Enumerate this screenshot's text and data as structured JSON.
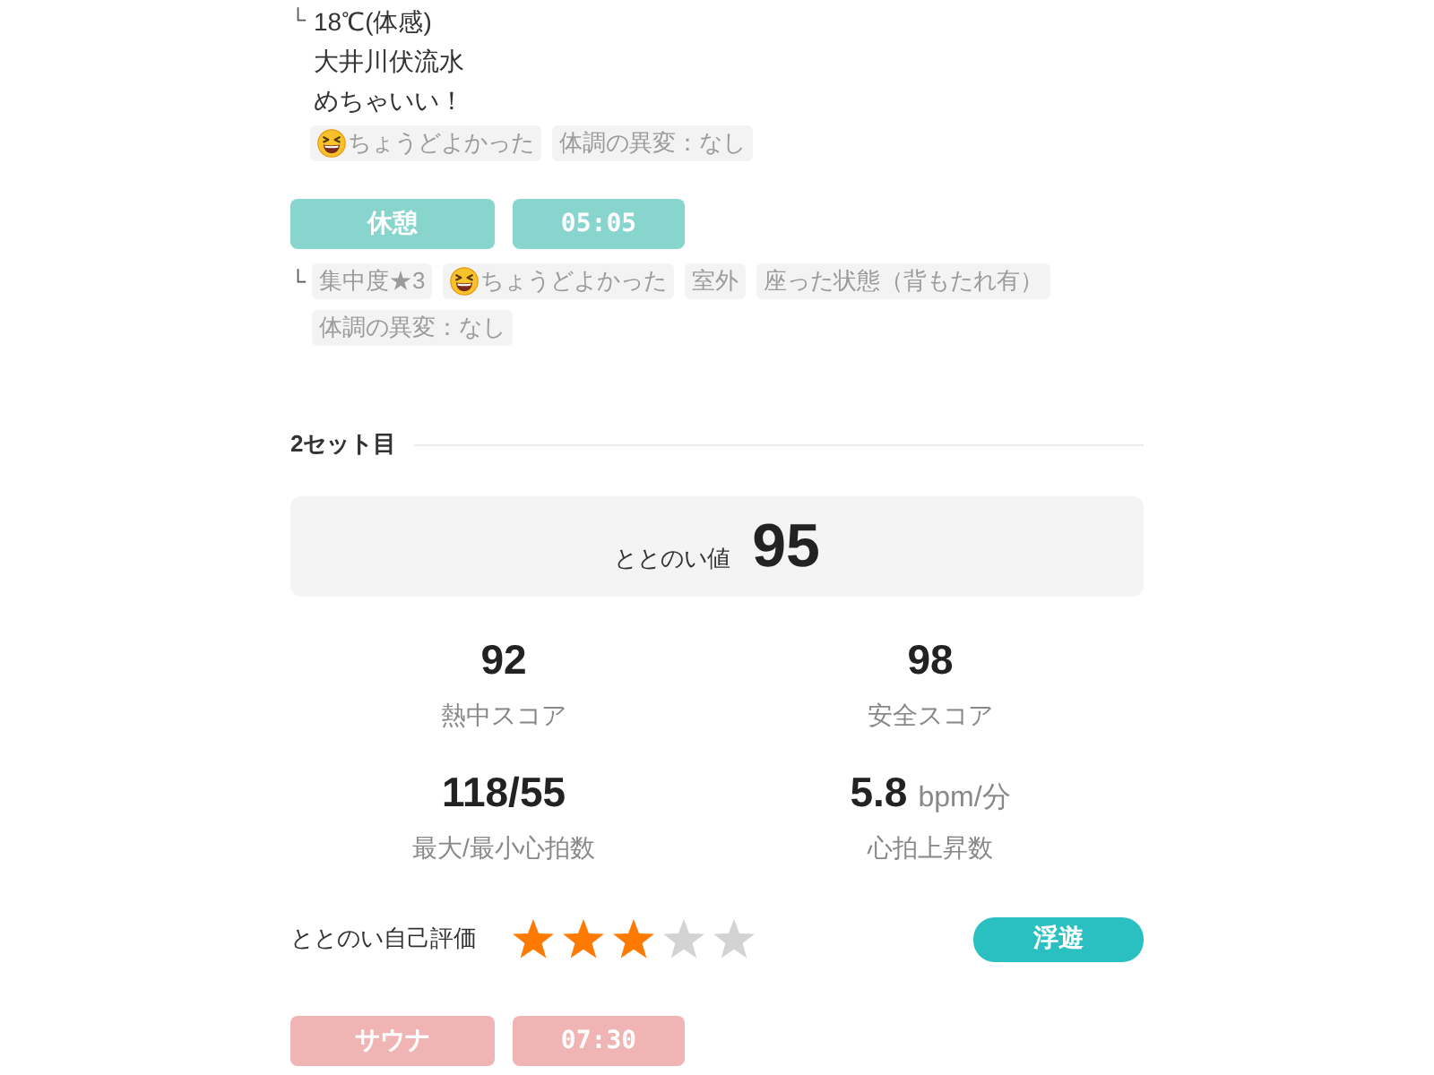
{
  "memo": {
    "prefix": "└",
    "lines": [
      "18℃(体感)",
      "大井川伏流水",
      "めちゃいい！"
    ],
    "tags": [
      {
        "kind": "mood",
        "label": "ちょうどよかった"
      },
      {
        "kind": "plain",
        "label": "体調の異変：なし"
      }
    ]
  },
  "break": {
    "kind": "rest",
    "label": "休憩",
    "time": "05:05",
    "prefix": "└",
    "tags": [
      {
        "kind": "plain",
        "label": "集中度★3"
      },
      {
        "kind": "mood",
        "label": "ちょうどよかった"
      },
      {
        "kind": "plain",
        "label": "室外"
      },
      {
        "kind": "plain",
        "label": "座った状態（背もたれ有）"
      },
      {
        "kind": "plain",
        "label": "体調の異変：なし"
      }
    ]
  },
  "set": {
    "title": "2セット目",
    "score": {
      "label": "ととのい値",
      "value": "95"
    },
    "stats": [
      {
        "value": "92",
        "label": "熱中スコア"
      },
      {
        "value": "98",
        "label": "安全スコア"
      },
      {
        "value": "118/55",
        "label": "最大/最小心拍数"
      },
      {
        "value": "5.8",
        "unit": "bpm/分",
        "label": "心拍上昇数"
      }
    ],
    "rating": {
      "label": "ととのい自己評価",
      "stars": 3,
      "feeling": "浮遊"
    }
  },
  "next": {
    "kind": "sauna",
    "label": "サウナ",
    "time": "07:30"
  }
}
